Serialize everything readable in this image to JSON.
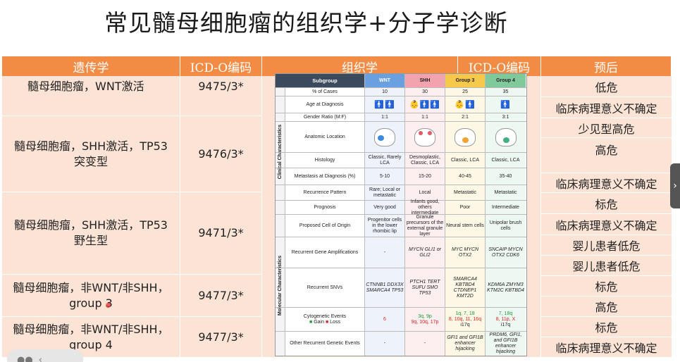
{
  "title": "常见髓母细胞瘤的组织学+分子学诊断",
  "headers": {
    "genetics": "遗传学",
    "icd1": "ICD-O编码",
    "histology": "组织学",
    "icd2": "ICD-O编码",
    "prognosis": "预后"
  },
  "rows": [
    {
      "genetics": "髓母细胞瘤，WNT激活",
      "icd": "9475/3*"
    },
    {
      "genetics": "髓母细胞瘤，SHH激活，TP53突变型",
      "icd": "9476/3*"
    },
    {
      "genetics": "髓母细胞瘤，SHH激活，TP53野生型",
      "icd": "9471/3*"
    },
    {
      "genetics": "髓母细胞瘤，非WNT/非SHH，group 3",
      "icd": "9477/3*"
    },
    {
      "genetics": "髓母细胞瘤，非WNT/非SHH，group 4",
      "icd": "9477/3*"
    }
  ],
  "prognosis": [
    "低危",
    "临床病理意义不确定",
    "少见型高危",
    "高危",
    "临床病理意义不确定",
    "标危",
    "临床病理意义不确定",
    "婴儿患者低危",
    "婴儿患者低危",
    "标危",
    "高危",
    "标危",
    "临床病理意义不确定"
  ],
  "inner": {
    "head": {
      "subgroup": "Subgroup",
      "wnt": "WNT",
      "shh": "SHH",
      "g3": "Group 3",
      "g4": "Group 4"
    },
    "side_clinical": "Clinical Characteristics",
    "side_molecular": "Molecular Characteristics",
    "rows": [
      {
        "label": "% of Cases",
        "wnt": "10",
        "shh": "30",
        "g3": "25",
        "g4": "35"
      },
      {
        "label": "Age at Diagnosis",
        "wnt": "🚹🚹",
        "shh": "👶🚹🚹",
        "g3": "👶🚹",
        "g4": "🚹"
      },
      {
        "label": "Gender Ratio (M:F)",
        "wnt": "1:1",
        "shh": "1:1",
        "g3": "2:1",
        "g4": "3:1"
      },
      {
        "label": "Anatomic Location",
        "wnt": "",
        "shh": "",
        "g3": "",
        "g4": ""
      },
      {
        "label": "Histology",
        "wnt": "Classic, Rarely LCA",
        "shh": "Desmoplastic, Classic, LCA",
        "g3": "Classic, LCA",
        "g4": "Classic, LCA"
      },
      {
        "label": "Metastasis at Diagnosis (%)",
        "wnt": "5-10",
        "shh": "15-20",
        "g3": "40-45",
        "g4": "35-40"
      },
      {
        "label": "Recurrence Pattern",
        "wnt": "Rare; Local or metastatic",
        "shh": "Local",
        "g3": "Metastatic",
        "g4": "Metastatic"
      },
      {
        "label": "Prognosis",
        "wnt": "Very good",
        "shh": "Infants good, others intermediate",
        "g3": "Poor",
        "g4": "Intermediate"
      },
      {
        "label": "Proposed Cell of Origin",
        "wnt": "Progenitor cells in the lower rhombic lip",
        "shh": "Granule precursors of the external granule layer",
        "g3": "Neural stem cells",
        "g4": "Unipolar brush cells"
      },
      {
        "label": "Recurrent Gene Amplifications",
        "wnt": "-",
        "shh": "MYCN GLI1 or GLI2",
        "g3": "MYC MYCN OTX2",
        "g4": "SNCAIP MYCN OTX2 CDK6"
      },
      {
        "label": "Recurrent SNVs",
        "wnt": "CTNNB1 DDX3X SMARCA4 TP53",
        "shh": "PTCH1 TERT SUFU SMO TP53",
        "g3": "SMARCA4 KBTBD4 CTDNEP1 KMT2D",
        "g4": "KDM6A ZMYM3 KTM2C KBTBD4"
      },
      {
        "label": "Cytogenetic Events",
        "legend_gain": "Gain",
        "legend_loss": "Loss",
        "wnt": "6",
        "shh_gain": "3q, 9p",
        "shh_loss": "9q, 10q, 17p",
        "g3_gain": "1q, 7, 18",
        "g3_loss": "8, 10q, 11, 16q",
        "g3_tail": "i17q",
        "g4_gain": "7, 18q",
        "g4_loss": "8, 11p, X",
        "g4_tail": "i17q"
      },
      {
        "label": "Other Recurrent Genetic Events",
        "wnt": "-",
        "shh": "-",
        "g3": "GFI1 and GFI1B enhancer hijacking",
        "g4": "PRDM6, GFI1, and GFI1B enhancer hijacking"
      }
    ]
  },
  "colors": {
    "header": "#f28c44",
    "cell": "#fbe4d6"
  },
  "icons": [
    "chevron-right-icon",
    "toolbar-icon"
  ]
}
